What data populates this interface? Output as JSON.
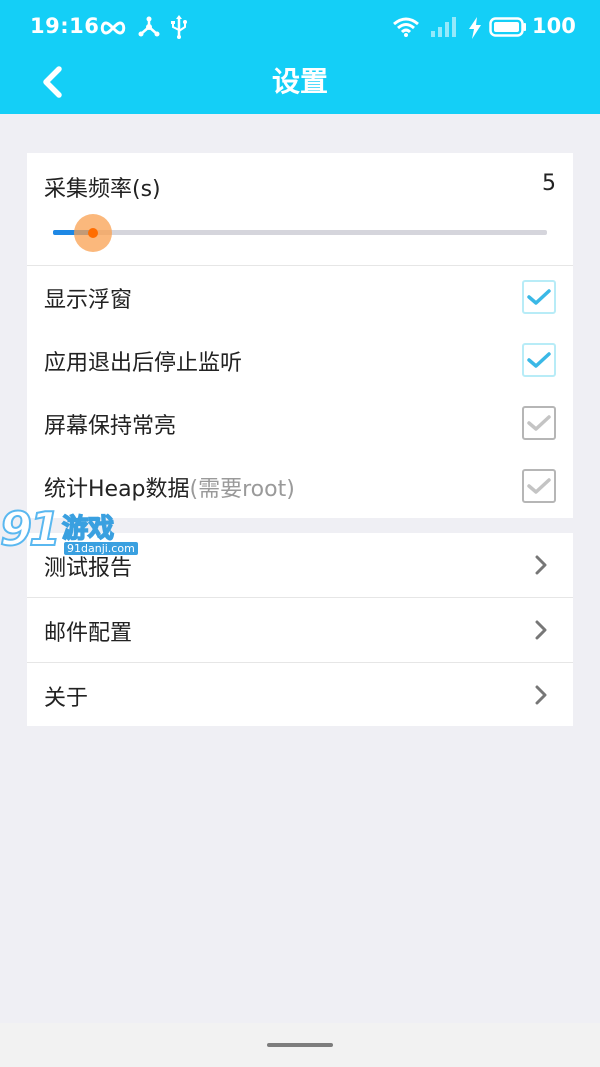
{
  "status_bar": {
    "time": "19:16",
    "battery": "100"
  },
  "header": {
    "title": "设置"
  },
  "settings": {
    "frequency": {
      "label": "采集频率(s)",
      "value": "5",
      "slider_fraction": 0.08
    },
    "toggles": [
      {
        "label": "显示浮窗",
        "note": "",
        "checked": true
      },
      {
        "label": "应用退出后停止监听",
        "note": "",
        "checked": true
      },
      {
        "label": "屏幕保持常亮",
        "note": "",
        "checked": false
      },
      {
        "label": "统计Heap数据",
        "note": "(需要root)",
        "checked": false
      }
    ],
    "nav_items": [
      {
        "label": "测试报告"
      },
      {
        "label": "邮件配置"
      },
      {
        "label": "关于"
      }
    ]
  },
  "watermark": {
    "logo_text": "91游戏",
    "url": "91danji.com"
  },
  "colors": {
    "header_bg": "#14cff7",
    "page_bg": "#efeff4",
    "checked_tick": "#3ab8e6",
    "unchecked_tick": "#c4c4c4",
    "slider_fill": "#1e88e5",
    "slider_thumb": "#ff6d00"
  },
  "icons": {
    "back": "chevron-left-icon",
    "nav": "chevron-right-icon",
    "status": [
      "infinity-icon",
      "share-icon",
      "usb-icon",
      "wifi-icon",
      "signal-icon",
      "charging-icon",
      "battery-icon"
    ]
  }
}
